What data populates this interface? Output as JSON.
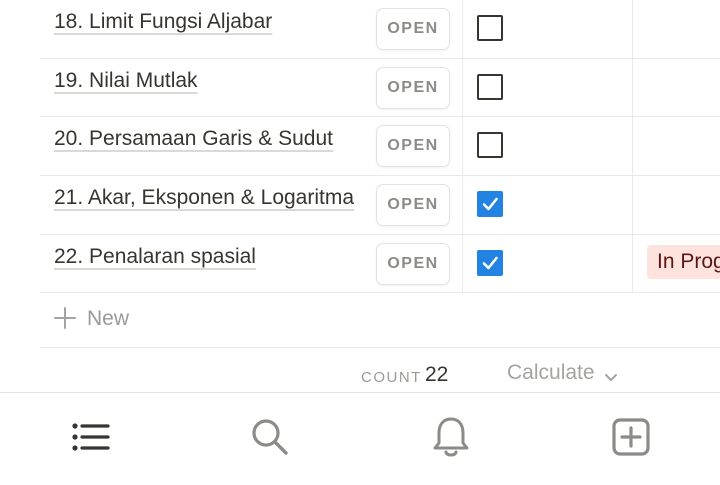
{
  "rows": [
    {
      "name": "18. Limit Fungsi Aljabar",
      "open_label": "OPEN",
      "done": false,
      "status": ""
    },
    {
      "name": "19. Nilai Mutlak",
      "open_label": "OPEN",
      "done": false,
      "status": ""
    },
    {
      "name": "20. Persamaan Garis & Sudut",
      "open_label": "OPEN",
      "done": false,
      "status": ""
    },
    {
      "name": "21. Akar, Eksponen & Logaritma",
      "open_label": "OPEN",
      "done": true,
      "status": ""
    },
    {
      "name": "22. Penalaran spasial",
      "open_label": "OPEN",
      "done": true,
      "status": "In Prog"
    }
  ],
  "new_row": {
    "label": "New",
    "icon": "plus-icon"
  },
  "footer": {
    "count_label": "COUNT",
    "count_value": "22",
    "calculate_label": "Calculate"
  },
  "bottom_nav": [
    {
      "icon": "list-icon"
    },
    {
      "icon": "search-icon"
    },
    {
      "icon": "bell-icon"
    },
    {
      "icon": "add-square-icon"
    }
  ],
  "colors": {
    "checkbox_checked": "#2383e2",
    "status_badge_bg": "#fde2dd",
    "status_badge_text": "#5d1715"
  }
}
